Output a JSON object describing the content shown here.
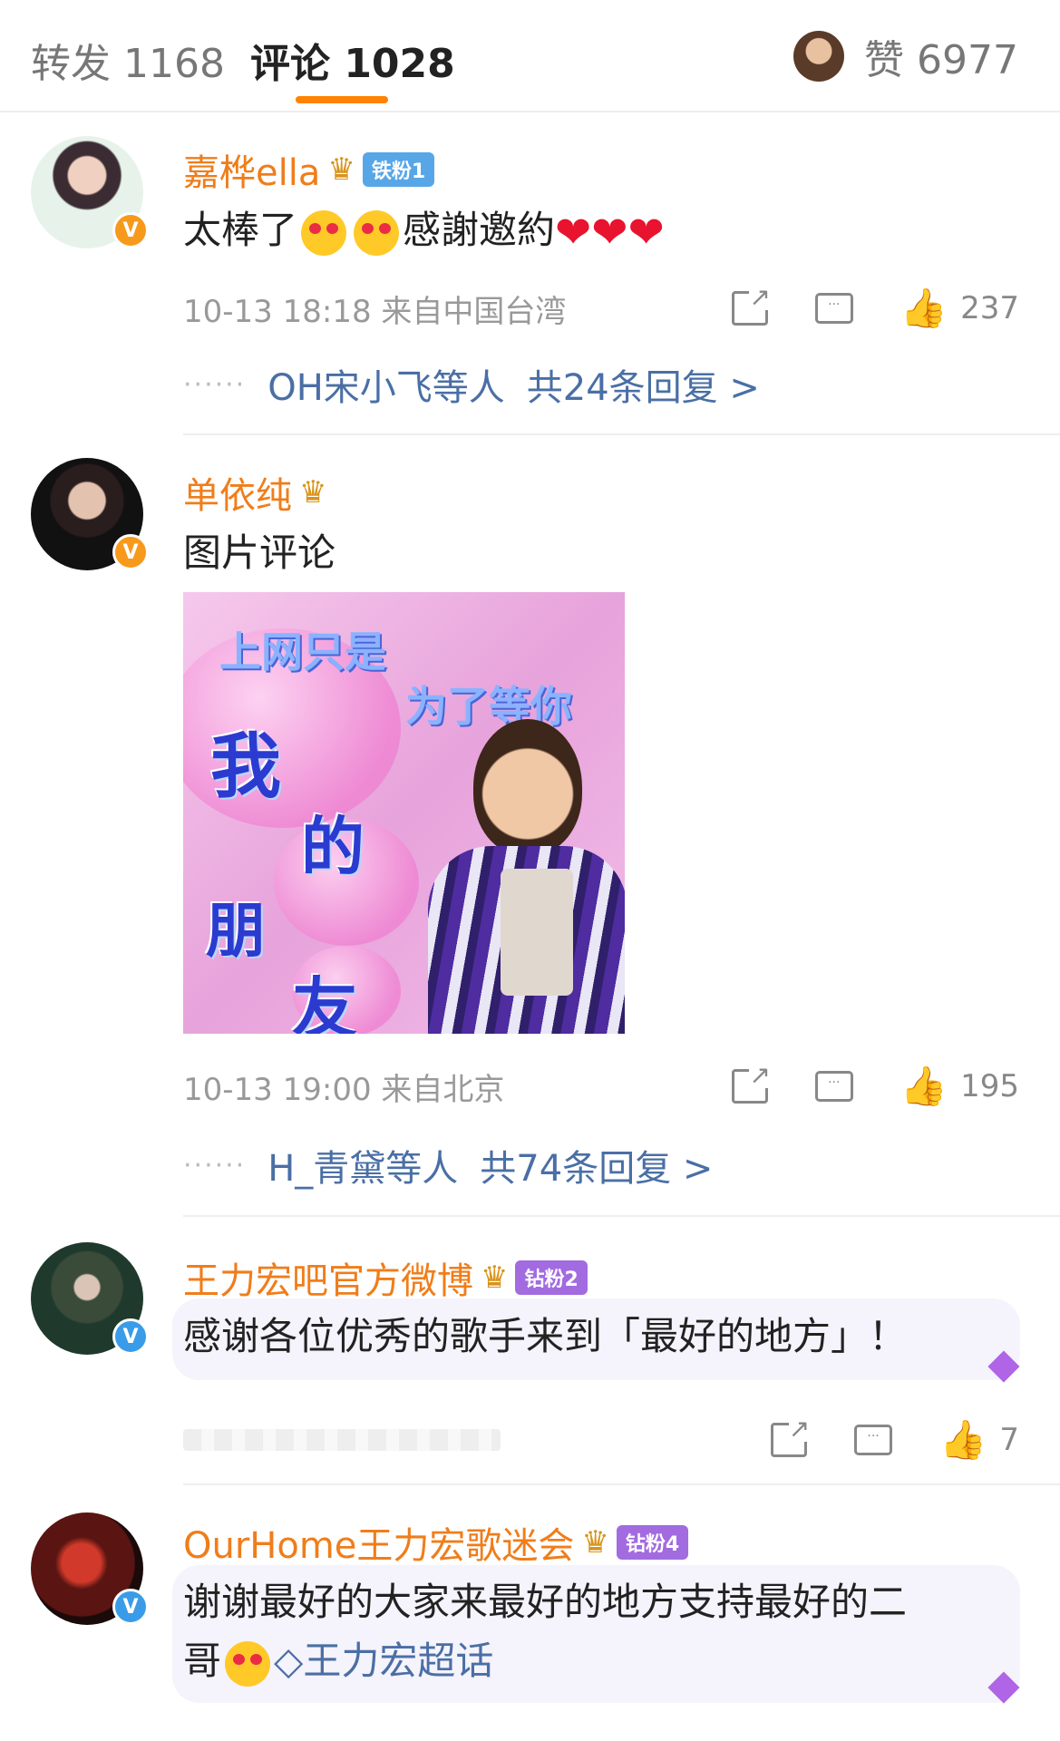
{
  "tabs": {
    "repost": "转发 1168",
    "comment": "评论 1028",
    "likes": "赞 6977"
  },
  "colors": {
    "accent": "#ff8200",
    "username": "#f07d1a",
    "link": "#4a6fa5",
    "meta": "#999999"
  },
  "comments": [
    {
      "username": "嘉桦ella",
      "crown_icon": "crown-icon",
      "fan_badge": "铁粉1",
      "verified": "orange-v",
      "text_parts": [
        "太棒了",
        "感謝邀約"
      ],
      "emojis": [
        "heart-eyes-emoji",
        "heart-eyes-emoji",
        "heart-emoji",
        "heart-emoji",
        "heart-emoji"
      ],
      "meta": "10-13 18:18 来自中国台湾",
      "likes": "237",
      "reply_users": "OH宋小飞等人",
      "reply_total": "共24条回复 >"
    },
    {
      "username": "单依纯",
      "crown_icon": "crown-icon",
      "verified": "orange-v",
      "text": "图片评论",
      "image": {
        "title_1": "上网只是",
        "title_2": "为了等你",
        "chars": [
          "我",
          "的",
          "朋",
          "友"
        ]
      },
      "meta": "10-13 19:00 来自北京",
      "likes": "195",
      "reply_users": "H_青黛等人",
      "reply_total": "共74条回复 >"
    },
    {
      "username": "王力宏吧官方微博",
      "crown_icon": "crown-icon",
      "fan_badge": "钻粉2",
      "verified": "blue-v",
      "text": "感谢各位优秀的歌手来到「最好的地方」！",
      "likes": "7"
    },
    {
      "username": "OurHome王力宏歌迷会",
      "crown_icon": "crown-icon",
      "fan_badge": "钻粉4",
      "verified": "blue-v",
      "text_line_1": "谢谢最好的大家来最好的地方支持最好的二",
      "text_line_2_prefix": "哥",
      "topic": "王力宏超话"
    }
  ]
}
